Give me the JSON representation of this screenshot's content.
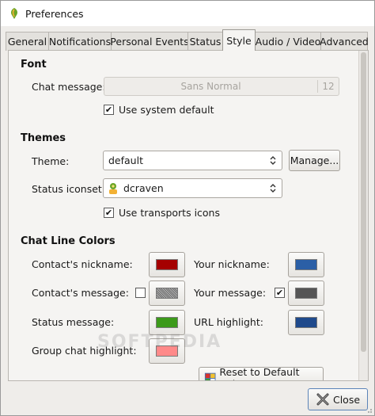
{
  "window": {
    "title": "Preferences",
    "app_icon": "psi-leaf-icon"
  },
  "tabs": [
    {
      "label": "General",
      "active": false
    },
    {
      "label": "Notifications",
      "active": false
    },
    {
      "label": "Personal Events",
      "active": false
    },
    {
      "label": "Status",
      "active": false
    },
    {
      "label": "Style",
      "active": true
    },
    {
      "label": "Audio / Video",
      "active": false
    },
    {
      "label": "Advanced",
      "active": false
    }
  ],
  "font": {
    "section_title": "Font",
    "chat_message_label": "Chat message:",
    "font_name": "Sans Normal",
    "font_size": "12",
    "use_system_default": {
      "label": "Use system default",
      "checked": true
    }
  },
  "themes": {
    "section_title": "Themes",
    "theme_label": "Theme:",
    "theme_value": "default",
    "manage_label": "Manage...",
    "iconset_label": "Status iconset:",
    "iconset_value": "dcraven",
    "iconset_icon": "dcraven-status-icon",
    "use_transports_icons": {
      "label": "Use transports icons",
      "checked": true
    }
  },
  "chat_line_colors": {
    "section_title": "Chat Line Colors",
    "contacts_nickname": {
      "label": "Contact's nickname:",
      "color": "#a50000"
    },
    "your_nickname": {
      "label": "Your nickname:",
      "color": "#2b5fa6"
    },
    "contacts_message": {
      "label": "Contact's message:",
      "color": "#7a7a7a",
      "checked": false
    },
    "your_message": {
      "label": "Your message:",
      "color": "#555555",
      "checked": true
    },
    "status_message": {
      "label": "Status message:",
      "color": "#3c9a1a"
    },
    "url_highlight": {
      "label": "URL highlight:",
      "color": "#1f4a8c"
    },
    "group_chat_highlight": {
      "label": "Group chat highlight:",
      "color": "#ff8a8a"
    },
    "reset_label": "Reset to Default Colors"
  },
  "footer": {
    "close_label": "Close"
  },
  "watermark": "SOFTPEDIA"
}
